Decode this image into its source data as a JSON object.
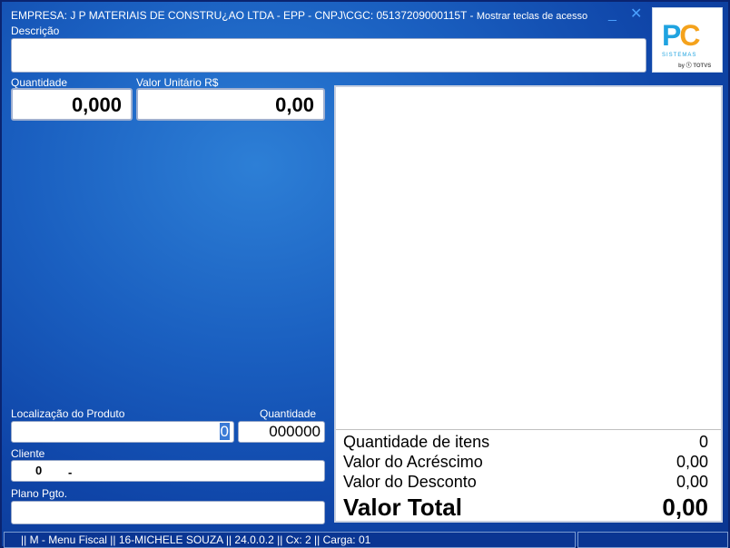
{
  "title_bar": {
    "company": "EMPRESA: J P MATERIAIS DE CONSTRU¿AO LTDA - EPP   -   CNPJ\\CGC: 05137209000115T - ",
    "shortcut_hint": "Mostrar teclas de acesso",
    "minimize_glyph": "_",
    "close_glyph": "✕"
  },
  "logo": {
    "pc_p": "P",
    "pc_c": "C",
    "sistemas": "SISTEMAS",
    "by": "by ⓣ TOTVS"
  },
  "descricao": {
    "label": "Descrição",
    "value": ""
  },
  "quantidade": {
    "label": "Quantidade",
    "value": "0,000"
  },
  "valor_unitario": {
    "label": "Valor Unitário R$",
    "value": "0,00"
  },
  "localizacao": {
    "label": "Localização do Produto",
    "value": "0"
  },
  "quantidade2": {
    "label": "Quantidade",
    "value": "000000"
  },
  "cliente": {
    "label": "Cliente",
    "code": "0",
    "name": "-"
  },
  "plano_pgto": {
    "label": "Plano Pgto.",
    "value": ""
  },
  "totals": {
    "qtd_itens": {
      "label": "Quantidade de itens",
      "value": "0"
    },
    "acrescimo": {
      "label": "Valor do Acréscimo",
      "value": "0,00"
    },
    "desconto": {
      "label": "Valor do Desconto",
      "value": "0,00"
    },
    "total": {
      "label": "Valor Total",
      "value": "0,00"
    }
  },
  "status_bar": {
    "text": "||    M - Menu Fiscal    ||    16-MICHELE SOUZA    ||    24.0.0.2    ||    Cx: 2    ||    Carga: 01"
  },
  "colors": {
    "background": "#1a5fc0",
    "logo_blue": "#1fa3e0",
    "logo_orange": "#f4a21c",
    "status_bar": "#0a3592"
  }
}
